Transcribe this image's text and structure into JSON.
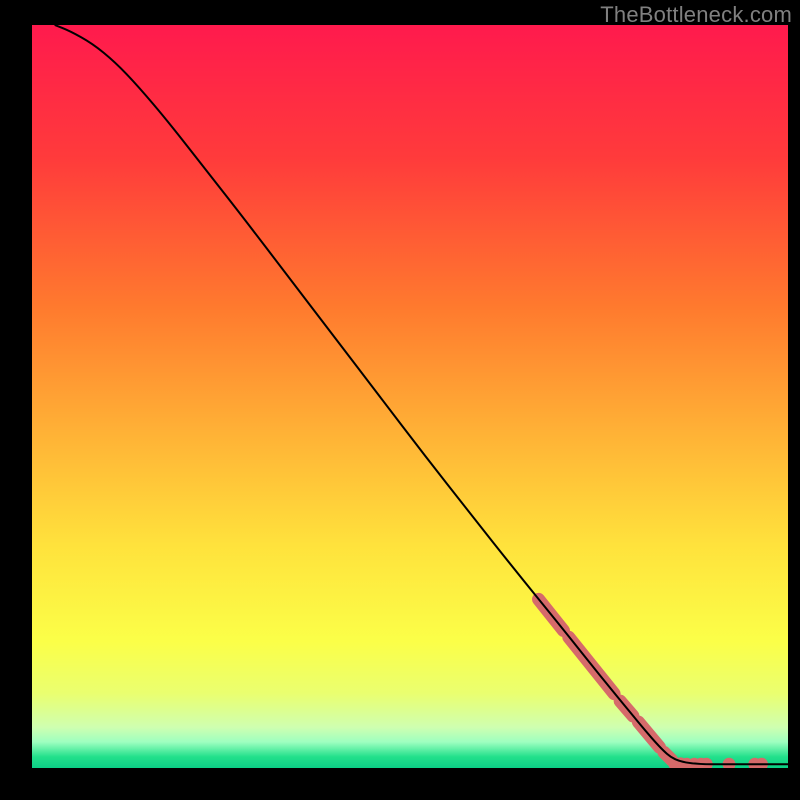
{
  "watermark": "TheBottleneck.com",
  "chart_data": {
    "type": "line",
    "title": "",
    "xlabel": "",
    "ylabel": "",
    "xlim": [
      0,
      100
    ],
    "ylim": [
      0,
      100
    ],
    "curve": {
      "name": "bottleneck-curve",
      "color": "#000000",
      "points": [
        {
          "x": 3.0,
          "y": 100.0
        },
        {
          "x": 5.0,
          "y": 99.2
        },
        {
          "x": 8.0,
          "y": 97.5
        },
        {
          "x": 11.0,
          "y": 95.0
        },
        {
          "x": 14.0,
          "y": 91.8
        },
        {
          "x": 18.0,
          "y": 87.0
        },
        {
          "x": 23.0,
          "y": 80.5
        },
        {
          "x": 28.0,
          "y": 74.0
        },
        {
          "x": 34.0,
          "y": 66.0
        },
        {
          "x": 40.0,
          "y": 58.0
        },
        {
          "x": 46.0,
          "y": 50.0
        },
        {
          "x": 52.0,
          "y": 42.0
        },
        {
          "x": 58.0,
          "y": 34.2
        },
        {
          "x": 64.0,
          "y": 26.5
        },
        {
          "x": 70.0,
          "y": 19.0
        },
        {
          "x": 75.0,
          "y": 12.6
        },
        {
          "x": 80.0,
          "y": 6.4
        },
        {
          "x": 83.0,
          "y": 2.8
        },
        {
          "x": 85.0,
          "y": 1.0
        },
        {
          "x": 88.0,
          "y": 0.5
        },
        {
          "x": 92.0,
          "y": 0.5
        },
        {
          "x": 96.0,
          "y": 0.5
        },
        {
          "x": 100.0,
          "y": 0.5
        }
      ]
    },
    "marker_segments": {
      "name": "highlight-markers",
      "color": "#d66a6a",
      "segments": [
        {
          "x0": 67.0,
          "y0": 22.7,
          "x1": 70.3,
          "y1": 18.5
        },
        {
          "x0": 71.0,
          "y0": 17.6,
          "x1": 77.0,
          "y1": 10.0
        },
        {
          "x0": 77.8,
          "y0": 9.0,
          "x1": 79.5,
          "y1": 7.0
        },
        {
          "x0": 80.2,
          "y0": 6.2,
          "x1": 83.0,
          "y1": 2.8
        },
        {
          "x0": 83.6,
          "y0": 2.1,
          "x1": 84.6,
          "y1": 1.1
        }
      ],
      "dots": [
        {
          "x": 85.0,
          "y": 0.6
        },
        {
          "x": 85.8,
          "y": 0.55
        },
        {
          "x": 86.6,
          "y": 0.5
        },
        {
          "x": 87.6,
          "y": 0.5
        },
        {
          "x": 88.5,
          "y": 0.5
        },
        {
          "x": 89.2,
          "y": 0.5
        },
        {
          "x": 92.2,
          "y": 0.5
        },
        {
          "x": 95.6,
          "y": 0.5
        },
        {
          "x": 96.5,
          "y": 0.5
        }
      ]
    },
    "gradient_stops": [
      {
        "offset": 0.0,
        "color": "#ff1a4d"
      },
      {
        "offset": 0.18,
        "color": "#ff3b3b"
      },
      {
        "offset": 0.38,
        "color": "#ff7a2e"
      },
      {
        "offset": 0.55,
        "color": "#ffb236"
      },
      {
        "offset": 0.7,
        "color": "#ffe23c"
      },
      {
        "offset": 0.83,
        "color": "#fbff48"
      },
      {
        "offset": 0.9,
        "color": "#eaff70"
      },
      {
        "offset": 0.945,
        "color": "#cfffb0"
      },
      {
        "offset": 0.965,
        "color": "#9effc0"
      },
      {
        "offset": 0.985,
        "color": "#22e08b"
      },
      {
        "offset": 1.0,
        "color": "#0ccf86"
      }
    ]
  }
}
